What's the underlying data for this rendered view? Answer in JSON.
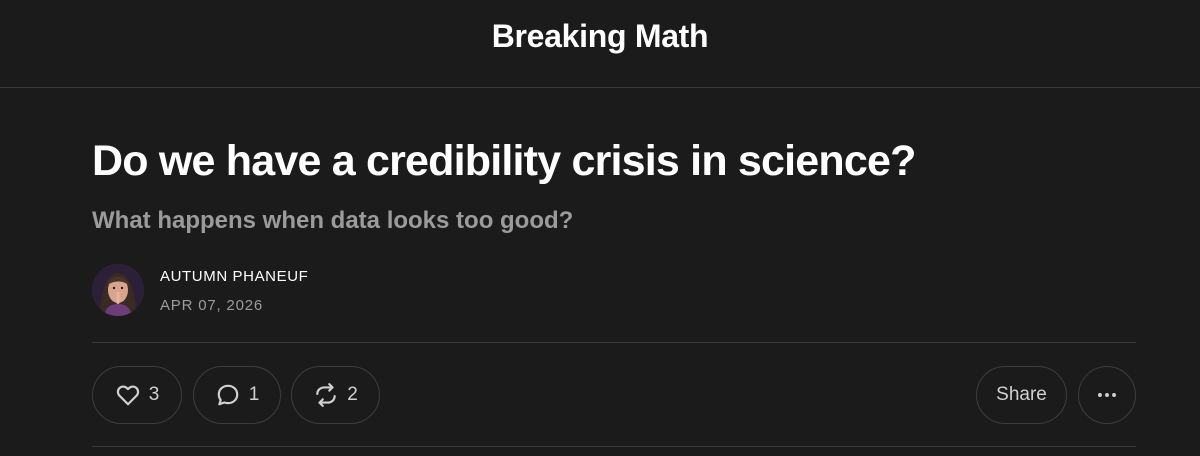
{
  "header": {
    "publication_name": "Breaking Math"
  },
  "post": {
    "title": "Do we have a credibility crisis in science?",
    "subtitle": "What happens when data looks too good?",
    "author": "AUTUMN PHANEUF",
    "date": "APR 07, 2026"
  },
  "actions": {
    "like_count": "3",
    "comment_count": "1",
    "restack_count": "2",
    "share_label": "Share",
    "icons": {
      "like": "heart-icon",
      "comment": "comment-bubble-icon",
      "restack": "restack-icon",
      "more": "ellipsis-icon"
    }
  },
  "colors": {
    "background": "#1b1b1b",
    "text_primary": "#ffffff",
    "text_secondary": "#9b9b9b",
    "border": "#3a3a3a"
  }
}
